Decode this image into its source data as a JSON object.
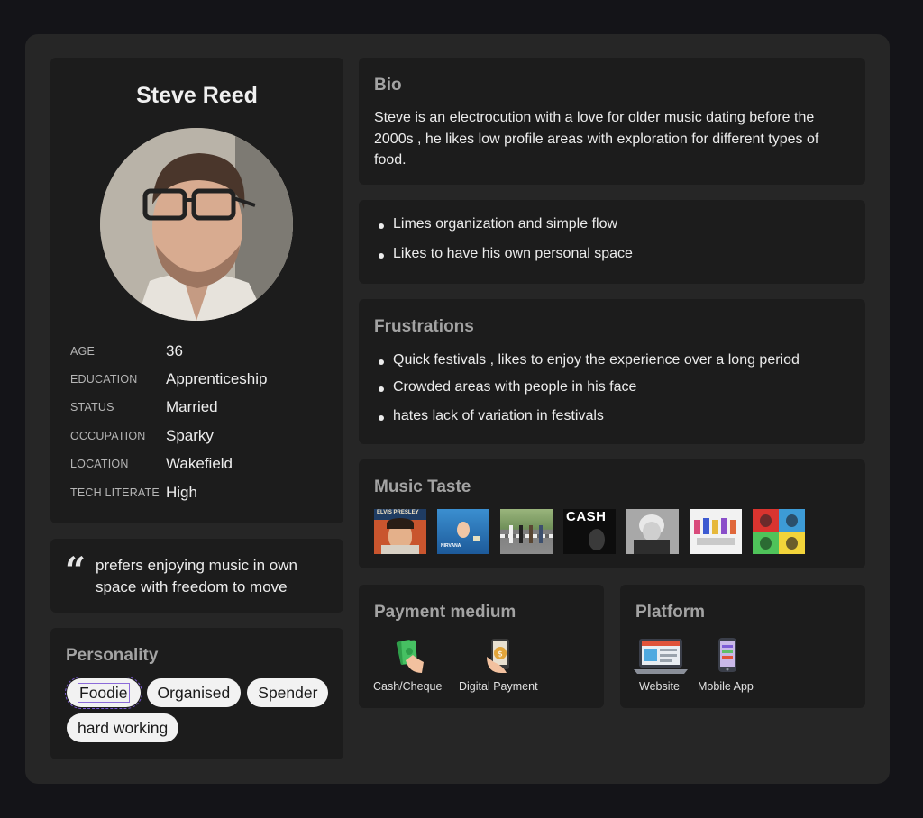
{
  "profile": {
    "name": "Steve Reed",
    "fields": [
      {
        "label": "AGE",
        "value": "36"
      },
      {
        "label": "EDUCATION",
        "value": "Apprenticeship"
      },
      {
        "label": "STATUS",
        "value": "Married"
      },
      {
        "label": "OCCUPATION",
        "value": "Sparky"
      },
      {
        "label": "LOCATION",
        "value": "Wakefield"
      },
      {
        "label": "TECH LITERATE",
        "value": "High"
      }
    ]
  },
  "quote": {
    "mark": "“",
    "text": "prefers enjoying music in own space with freedom to move"
  },
  "personality": {
    "title": "Personality",
    "tags": [
      "Foodie",
      "Organised",
      "Spender",
      "hard working"
    ]
  },
  "bio": {
    "title": "Bio",
    "text": "Steve is an electrocution with a love for older music dating before the 2000s , he likes low profile areas with exploration for different types of food."
  },
  "likes": {
    "items": [
      "Limes organization and simple flow",
      "Likes to have his own personal space"
    ]
  },
  "frustrations": {
    "title": "Frustrations",
    "items": [
      "Quick festivals , likes to enjoy the experience over a long period",
      "Crowded areas with people in his face",
      "hates lack of variation in festivals"
    ]
  },
  "music": {
    "title": "Music Taste",
    "albums": [
      {
        "icon": "elvis-album-cover",
        "text": "ELVIS PRESLEY"
      },
      {
        "icon": "nevermind-album-cover",
        "text": "NIRVANA"
      },
      {
        "icon": "abbey-road-album-cover",
        "text": ""
      },
      {
        "icon": "cash-album-cover",
        "text": "CASH"
      },
      {
        "icon": "madonna-album-cover",
        "text": ""
      },
      {
        "icon": "spice-girls-album-cover",
        "text": ""
      },
      {
        "icon": "queen-album-cover",
        "text": ""
      }
    ]
  },
  "payment": {
    "title": "Payment medium",
    "items": [
      {
        "icon": "cash-hand-icon",
        "label": "Cash/Cheque"
      },
      {
        "icon": "phone-payment-icon",
        "label": "Digital Payment"
      }
    ]
  },
  "platform": {
    "title": "Platform",
    "items": [
      {
        "icon": "laptop-icon",
        "label": "Website"
      },
      {
        "icon": "mobile-phone-icon",
        "label": "Mobile App"
      }
    ]
  },
  "colors": {
    "background": "#141418",
    "panel": "#262626",
    "card": "#1c1c1c",
    "heading": "#a3a3a3",
    "tag_bg": "#f2f2f2",
    "selection": "#8b6ad9"
  }
}
